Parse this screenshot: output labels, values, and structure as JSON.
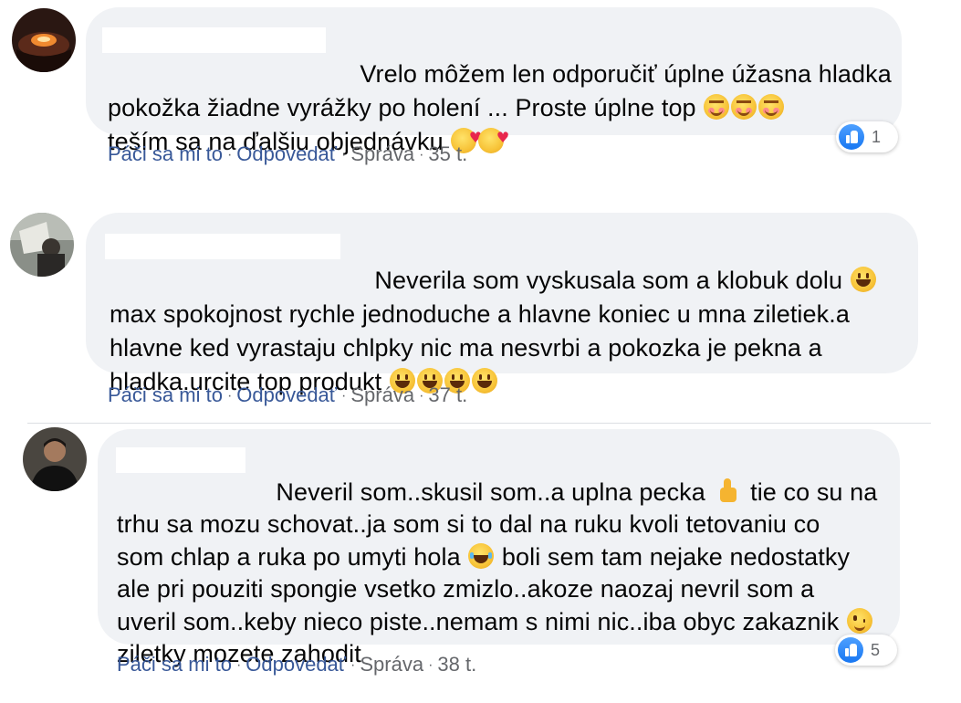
{
  "comments": [
    {
      "text_lines": [
        "Vrelo môžem len odporučiť úplne úžasna hladka",
        "pokožka žiadne vyrážky po holení ... Proste úplne top ",
        "teším sa na ďalšiu objednávku "
      ],
      "emoji_line2": [
        "smiling-face-icon",
        "smiling-face-icon",
        "smiling-face-icon"
      ],
      "emoji_line3": [
        "smiling-face-with-hearts-icon",
        "smiling-face-with-hearts-icon"
      ],
      "actions": {
        "like": "Páči sa mi to",
        "reply": "Odpovedať",
        "message": "Správa",
        "time": "35 t."
      },
      "reaction_count": "1"
    },
    {
      "text_lines": [
        "Neverila som vyskusala som a klobuk dolu ",
        "max spokojnost rychle jednoduche a hlavne koniec u mna ziletiek.a",
        "hlavne ked vyrastaju chlpky nic ma nesvrbi a pokozka je pekna a",
        "hladka.urcite top produkt "
      ],
      "emoji_line1": [
        "grinning-face-icon"
      ],
      "emoji_line4": [
        "grinning-face-icon",
        "grinning-face-icon",
        "grinning-face-icon",
        "grinning-face-icon"
      ],
      "actions": {
        "like": "Páči sa mi to",
        "reply": "Odpovedať",
        "message": "Správa",
        "time": "37 t."
      }
    },
    {
      "text_lines": [
        "Neveril som..skusil som..a uplna pecka ",
        " tie co su na",
        "trhu sa mozu schovat..ja som si to dal na ruku kvoli tetovaniu co",
        "som chlap a ruka po umyti hola ",
        " boli sem tam nejake nedostatky",
        "ale pri pouziti spongie vsetko zmizlo..akoze naozaj nevril som a",
        "uveril som..keby nieco piste..nemam s nimi nic..iba obyc zakaznik ",
        "ziletky mozete zahodit"
      ],
      "emoji_line1": [
        "thumbs-up-icon"
      ],
      "emoji_line3": [
        "tears-of-joy-icon"
      ],
      "emoji_line5": [
        "winking-face-icon"
      ],
      "actions": {
        "like": "Páči sa mi to",
        "reply": "Odpovedať",
        "message": "Správa",
        "time": "38 t."
      },
      "reaction_count": "5"
    }
  ],
  "colors": {
    "bubble": "#f0f2f5",
    "action_link": "#385898",
    "meta": "#65676b",
    "like_blue": "#1877f2"
  }
}
